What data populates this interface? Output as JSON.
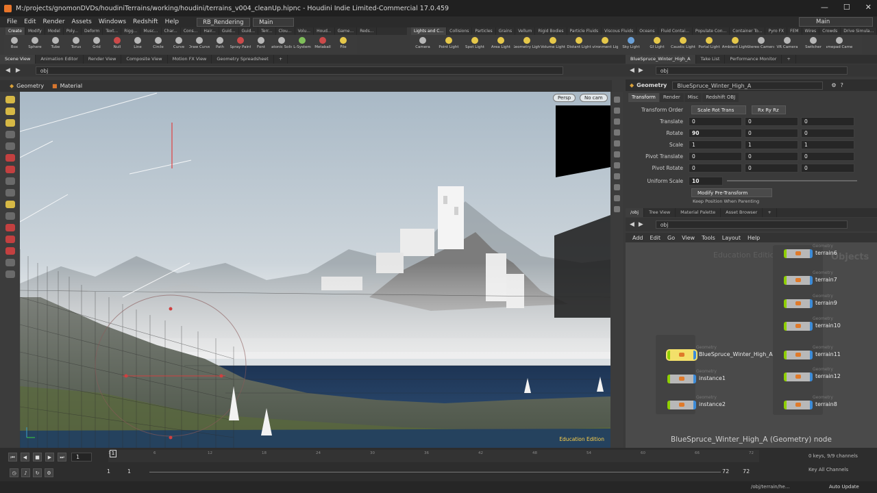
{
  "window": {
    "title": "M:/projects/gnomonDVDs/houdiniTerrains/working/houdini/terrains_v004_cleanUp.hipnc - Houdini Indie Limited-Commercial 17.0.459",
    "min": "—",
    "max": "☐",
    "close": "✕"
  },
  "menu": {
    "items": [
      "File",
      "Edit",
      "Render",
      "Assets",
      "Windows",
      "Redshift",
      "Help"
    ],
    "desktop": "RB_Rendering",
    "desktop2": "Main",
    "right_desktop": "Main"
  },
  "shelf_left": {
    "tabs": [
      "Create",
      "Modify",
      "Model",
      "Poly...",
      "Deform",
      "Text...",
      "Rigg...",
      "Musc...",
      "Char...",
      "Cons...",
      "Hair...",
      "Guid...",
      "Guid...",
      "Terr...",
      "Clou...",
      "Volu...",
      "Houd...",
      "Game...",
      "Reds..."
    ],
    "tools": [
      {
        "label": "Box",
        "icon": "box-icon",
        "c": ""
      },
      {
        "label": "Sphere",
        "icon": "sphere-icon",
        "c": ""
      },
      {
        "label": "Tube",
        "icon": "tube-icon",
        "c": ""
      },
      {
        "label": "Torus",
        "icon": "torus-icon",
        "c": ""
      },
      {
        "label": "Grid",
        "icon": "grid-icon",
        "c": ""
      },
      {
        "label": "Null",
        "icon": "null-icon",
        "c": "r"
      },
      {
        "label": "Line",
        "icon": "line-icon",
        "c": ""
      },
      {
        "label": "Circle",
        "icon": "circle-icon",
        "c": ""
      },
      {
        "label": "Curve",
        "icon": "curve-icon",
        "c": ""
      },
      {
        "label": "Draw Curve",
        "icon": "draw-curve-icon",
        "c": ""
      },
      {
        "label": "Path",
        "icon": "path-icon",
        "c": ""
      },
      {
        "label": "Spray Paint",
        "icon": "spray-paint-icon",
        "c": "r"
      },
      {
        "label": "Font",
        "icon": "font-icon",
        "c": ""
      },
      {
        "label": "Platonic Solids",
        "icon": "platonic-icon",
        "c": ""
      },
      {
        "label": "L-System",
        "icon": "lsystem-icon",
        "c": "g"
      },
      {
        "label": "Metaball",
        "icon": "metaball-icon",
        "c": "r"
      },
      {
        "label": "File",
        "icon": "file-icon",
        "c": "y"
      }
    ]
  },
  "shelf_right": {
    "tabs": [
      "Lights and C...",
      "Collisions",
      "Particles",
      "Grains",
      "Vellum",
      "Rigid Bodies",
      "Particle Fluids",
      "Viscous Fluids",
      "Oceans",
      "Fluid Contai...",
      "Populate Con...",
      "Container To...",
      "Pyro FX",
      "FEM",
      "Wires",
      "Crowds",
      "Drive Simula..."
    ],
    "tools": [
      {
        "label": "Camera",
        "icon": "camera-icon",
        "c": ""
      },
      {
        "label": "Point Light",
        "icon": "point-light-icon",
        "c": "y"
      },
      {
        "label": "Spot Light",
        "icon": "spot-light-icon",
        "c": "y"
      },
      {
        "label": "Area Light",
        "icon": "area-light-icon",
        "c": "y"
      },
      {
        "label": "Geometry Light",
        "icon": "geometry-light-icon",
        "c": "y"
      },
      {
        "label": "Volume Light",
        "icon": "volume-light-icon",
        "c": "y"
      },
      {
        "label": "Distant Light",
        "icon": "distant-light-icon",
        "c": "y"
      },
      {
        "label": "Environment Light",
        "icon": "environment-light-icon",
        "c": "y"
      },
      {
        "label": "Sky Light",
        "icon": "sky-light-icon",
        "c": "b"
      },
      {
        "label": "GI Light",
        "icon": "gi-light-icon",
        "c": "y"
      },
      {
        "label": "Caustic Light",
        "icon": "caustic-light-icon",
        "c": "y"
      },
      {
        "label": "Portal Light",
        "icon": "portal-light-icon",
        "c": "y"
      },
      {
        "label": "Ambient Light",
        "icon": "ambient-light-icon",
        "c": "y"
      },
      {
        "label": "Stereo Camera",
        "icon": "stereo-camera-icon",
        "c": ""
      },
      {
        "label": "VR Camera",
        "icon": "vr-camera-icon",
        "c": ""
      },
      {
        "label": "Switcher",
        "icon": "switcher-icon",
        "c": ""
      },
      {
        "label": "Gamepad Camera",
        "icon": "gamepad-camera-icon",
        "c": ""
      }
    ]
  },
  "viewport_tabs": [
    "Scene View",
    "Animation Editor",
    "Render View",
    "Composite View",
    "Motion FX View",
    "Geometry Spreadsheet"
  ],
  "viewport": {
    "path": "obj",
    "context1": "Geometry",
    "context2": "Material",
    "persp": "Persp",
    "cam": "No cam",
    "edu": "Education Edition"
  },
  "right_tabs": [
    "BlueSpruce_Winter_High_A",
    "Take List",
    "Performance Monitor"
  ],
  "parm": {
    "path": "obj",
    "type": "Geometry",
    "name": "BlueSpruce_Winter_High_A",
    "tabs": [
      "Transform",
      "Render",
      "Misc",
      "Redshift OBJ"
    ],
    "xform_order_label": "Transform Order",
    "xform_order": "Scale Rot Trans",
    "rot_order": "Rx Ry Rz",
    "rows": [
      {
        "label": "Translate",
        "v": [
          "0",
          "0",
          "0"
        ]
      },
      {
        "label": "Rotate",
        "v": [
          "90",
          "0",
          "0"
        ]
      },
      {
        "label": "Scale",
        "v": [
          "1",
          "1",
          "1"
        ]
      },
      {
        "label": "Pivot Translate",
        "v": [
          "0",
          "0",
          "0"
        ]
      },
      {
        "label": "Pivot Rotate",
        "v": [
          "0",
          "0",
          "0"
        ]
      }
    ],
    "uniform_label": "Uniform Scale",
    "uniform": "10",
    "modify": "Modify Pre-Transform",
    "keep": "Keep Position When Parenting"
  },
  "net_tabs": [
    "/obj",
    "Tree View",
    "Material Palette",
    "Asset Browser"
  ],
  "net": {
    "path": "obj",
    "menu": [
      "Add",
      "Edit",
      "Go",
      "View",
      "Tools",
      "Layout",
      "Help"
    ],
    "watermark1": "Education Edition",
    "watermark2": "Objects",
    "tag": "Geometry",
    "left_nodes": [
      "BlueSpruce_Winter_High_A",
      "instance1",
      "instance2"
    ],
    "right_nodes": [
      "terrain6",
      "terrain7",
      "terrain9",
      "terrain10",
      "terrain11",
      "terrain12",
      "terrain8"
    ],
    "caption": "BlueSpruce_Winter_High_A (Geometry) node"
  },
  "timeline": {
    "frame": "1",
    "start": "1",
    "start2": "1",
    "end": "72",
    "end2": "72",
    "ticks": [
      "1",
      "6",
      "12",
      "18",
      "24",
      "30",
      "36",
      "42",
      "48",
      "54",
      "60",
      "66",
      "72"
    ],
    "keys": "0 keys, 9/9 channels",
    "allkeys": "Key All Channels",
    "autoupdate": "Auto Update",
    "status_path": "/obj/terrain/he..."
  }
}
